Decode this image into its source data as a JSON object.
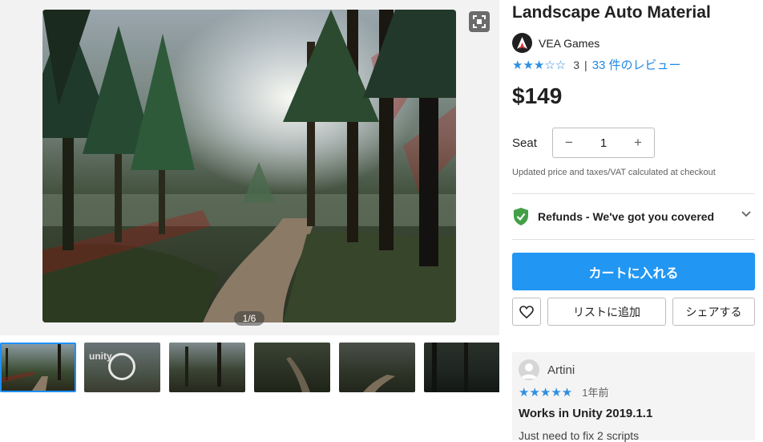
{
  "gallery": {
    "counter": "1/6",
    "thumbnail_count": 6,
    "thumbnails": [
      {
        "kind": "image",
        "active": true
      },
      {
        "kind": "video",
        "text": "unity"
      },
      {
        "kind": "image"
      },
      {
        "kind": "image"
      },
      {
        "kind": "image"
      },
      {
        "kind": "image"
      }
    ],
    "icons": {
      "fullscreen": "fullscreen-icon",
      "play": "play-icon"
    }
  },
  "product": {
    "title": "Landscape Auto Material",
    "publisher": "VEA Games",
    "rating_stars": 3,
    "rating_max": 5,
    "rating_value": "3",
    "rating_separator": "|",
    "reviews_link": "33 件のレビュー",
    "price": "$149"
  },
  "purchase": {
    "seat_label": "Seat",
    "seat_decrement": "−",
    "seat_increment": "+",
    "seat_quantity": "1",
    "price_note": "Updated price and taxes/VAT calculated at checkout",
    "refund_text": "Refunds - We've got you covered",
    "add_to_cart": "カートに入れる",
    "add_to_list": "リストに追加",
    "share": "シェアする"
  },
  "review": {
    "reviewer": "Artini",
    "stars": 5,
    "date": "1年前",
    "title": "Works in Unity 2019.1.1",
    "body": "Just need to fix 2 scripts"
  },
  "colors": {
    "accent": "#2196f3",
    "link": "#1e88e5",
    "star": "#2f8fe0",
    "refund_shield": "#43a047"
  }
}
